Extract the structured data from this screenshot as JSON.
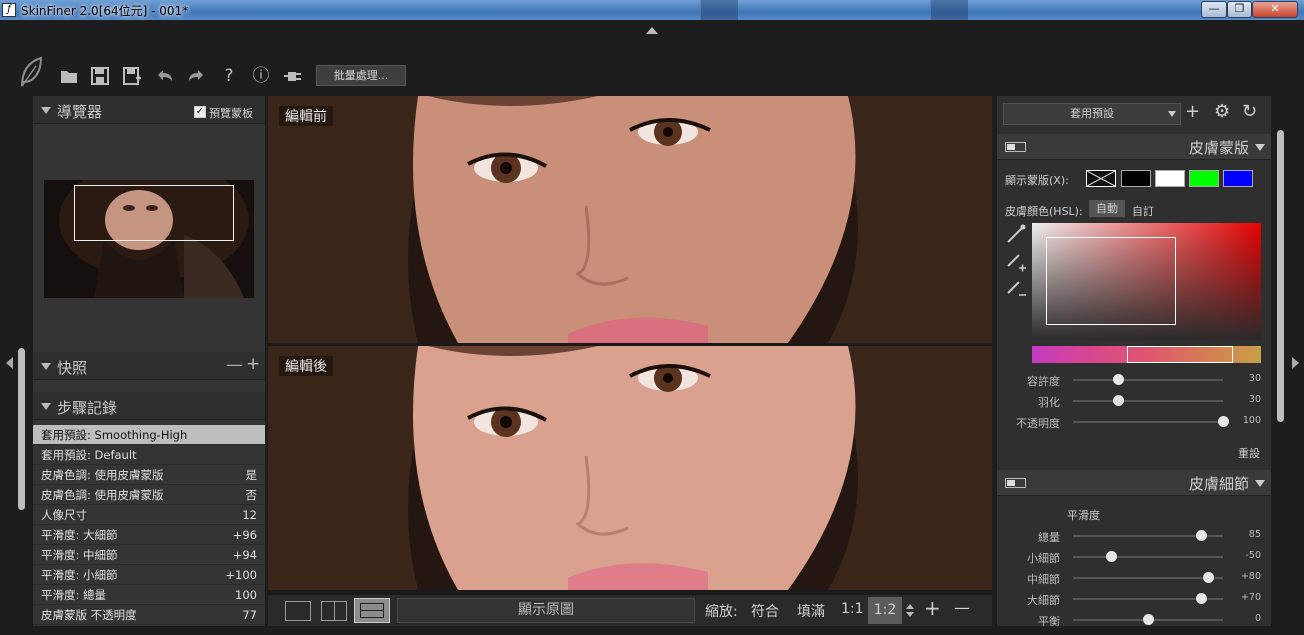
{
  "titlebar": {
    "title": "SkinFiner 2.0[64位元] - 001*",
    "icon_glyph": "ƒ",
    "min_glyph": "—",
    "max_glyph": "❐",
    "close_glyph": "✕"
  },
  "toolbar": {
    "icons": [
      "leaf-logo-icon",
      "folder-open-icon",
      "save-icon",
      "save-as-icon",
      "undo-icon",
      "redo-icon",
      "help-icon",
      "info-icon",
      "plugin-icon"
    ],
    "glyphs": {
      "folder": "▬",
      "save": "💾",
      "save_as": "⧉",
      "undo": "↶",
      "redo": "↷",
      "help": "?",
      "info": "ⓘ",
      "plugin": "⊸"
    },
    "batch_label": "批量處理..."
  },
  "left": {
    "navigator": {
      "title": "導覽器",
      "preview_label": "預覽蒙板",
      "preview_checked": "✓"
    },
    "snapshot": {
      "title": "快照",
      "minus": "—",
      "plus": "+"
    },
    "history": {
      "title": "步驟記錄",
      "rows": [
        {
          "label": "套用預設: Smoothing-High",
          "value": ""
        },
        {
          "label": "套用預設: Default",
          "value": ""
        },
        {
          "label": "皮膚色調: 使用皮膚蒙版",
          "value": "是"
        },
        {
          "label": "皮膚色調: 使用皮膚蒙版",
          "value": "否"
        },
        {
          "label": "人像尺寸",
          "value": "12"
        },
        {
          "label": "平滑度: 大細節",
          "value": "+96"
        },
        {
          "label": "平滑度: 中細節",
          "value": "+94"
        },
        {
          "label": "平滑度: 小細節",
          "value": "+100"
        },
        {
          "label": "平滑度: 總量",
          "value": "100"
        },
        {
          "label": "皮膚蒙版 不透明度",
          "value": "77"
        }
      ]
    }
  },
  "center": {
    "before_label": "編輯前",
    "after_label": "編輯後",
    "show_original": "顯示原圖",
    "zoom_label": "縮放:",
    "zoom_options": [
      "符合",
      "填滿",
      "1:1",
      "1:2"
    ],
    "zoom_plus": "+",
    "zoom_minus": "—",
    "colors": {
      "hair": "#3a2519",
      "skin": "#c98f78",
      "lips": "#d9707e",
      "eye": "#5b3420"
    }
  },
  "right": {
    "preset_label": "套用預設",
    "icons": {
      "plus": "+",
      "gear": "⚙",
      "refresh": "↻"
    },
    "skin_mask": {
      "title": "皮膚蒙版",
      "show_mask": "顯示蒙版(X):",
      "skin_color": "皮膚顏色(HSL):",
      "auto": "自動",
      "custom": "自訂",
      "swatches": [
        "#000000",
        "#ffffff",
        "#00ff00",
        "#0000ff"
      ],
      "sliders": [
        {
          "label": "容許度",
          "value": "30",
          "pos": 0.3
        },
        {
          "label": "羽化",
          "value": "30",
          "pos": 0.3
        },
        {
          "label": "不透明度",
          "value": "100",
          "pos": 1.0
        }
      ],
      "reset": "重設"
    },
    "skin_detail": {
      "title": "皮膚細節",
      "smooth_label": "平滑度",
      "sliders": [
        {
          "label": "總量",
          "value": "85",
          "pos": 0.85
        },
        {
          "label": "小細節",
          "value": "-50",
          "pos": 0.25
        },
        {
          "label": "中細節",
          "value": "+80",
          "pos": 0.9
        },
        {
          "label": "大細節",
          "value": "+70",
          "pos": 0.85
        },
        {
          "label": "平衡",
          "value": "0",
          "pos": 0.5
        }
      ]
    }
  }
}
